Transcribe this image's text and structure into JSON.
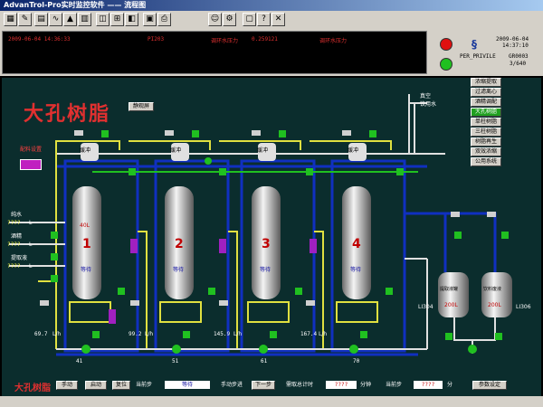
{
  "window": {
    "title": "AdvanTrol-Pro实时监控软件 —— 流程图"
  },
  "toolbar": {
    "icons": [
      "open-icon",
      "config-icon",
      "report-icon",
      "trend-icon",
      "alarm-icon",
      "group-icon",
      "overview-icon",
      "flow-icon",
      "control-icon",
      "data-icon",
      "print-icon",
      "user-icon",
      "system-icon",
      "lock-icon",
      "help-icon",
      "exit-icon"
    ]
  },
  "alarm": {
    "time": "2009-06-04 14:36:33",
    "tag": "PI203",
    "desc": "调环水压力",
    "value": "0.259121",
    "desc2": "调环水压力"
  },
  "info": {
    "date": "2009-06-04",
    "time": "14:37:10",
    "user": "PER_PRIVILE",
    "page_code": "GR0003",
    "page_num": "3/640"
  },
  "main": {
    "title": "大孔树脂",
    "title_button": "静观屏",
    "vacuum": "真空",
    "drinking_water": "饮用水",
    "conversion_btn": "配料设置"
  },
  "nav": [
    "浓缩提取",
    "过滤离心",
    "酒精调配",
    "大孔树脂",
    "单柱树脂",
    "三柱树脂",
    "树脂再生",
    "双效浓缩",
    "公用系统"
  ],
  "feed": [
    {
      "name": "纯水",
      "value": "????",
      "unit": "L"
    },
    {
      "name": "酒精",
      "value": "????",
      "unit": "L"
    },
    {
      "name": "提取液",
      "value": "????",
      "unit": "L"
    }
  ],
  "columns": [
    {
      "num": "1",
      "state": "等待",
      "top": "40L",
      "flow": "69.7",
      "flow_unit": "L/h",
      "bottom": "41"
    },
    {
      "num": "2",
      "state": "等待",
      "top": "",
      "flow": "99.2",
      "flow_unit": "L/h",
      "bottom": "51"
    },
    {
      "num": "3",
      "state": "等待",
      "top": "",
      "flow": "145.9",
      "flow_unit": "L/h",
      "bottom": "61"
    },
    {
      "num": "4",
      "state": "等待",
      "top": "",
      "flow": "167.4",
      "flow_unit": "L/h",
      "bottom": "70"
    }
  ],
  "top_label": "缓冲",
  "tanks": [
    {
      "name": "提取液罐",
      "level": "200L",
      "tag": "LI304"
    },
    {
      "name": "饮料废液",
      "level": "200L",
      "tag": "LI306"
    }
  ],
  "bottom": {
    "title": "大孔树脂",
    "manual": "手动",
    "start": "启动",
    "reset": "复位",
    "current_step": "当前步",
    "current_step_value": "等待",
    "manual_step": "手动步进",
    "next_step": "下一步",
    "total_time_label": "需取总计时",
    "total_time_value": "????",
    "minutes": "分钟",
    "current_step2": "当前步",
    "current_step2_value": "????",
    "minutes2": "分",
    "param_btn": "参数设定"
  },
  "colors": {
    "pipe_blue": "#1030c0",
    "pipe_yellow": "#e0e040",
    "pipe_white": "#e0e0e0",
    "pipe_green": "#20c020",
    "panel_bg": "#0b2d2d",
    "lamp_red": "#e01010",
    "lamp_green": "#20c020"
  }
}
